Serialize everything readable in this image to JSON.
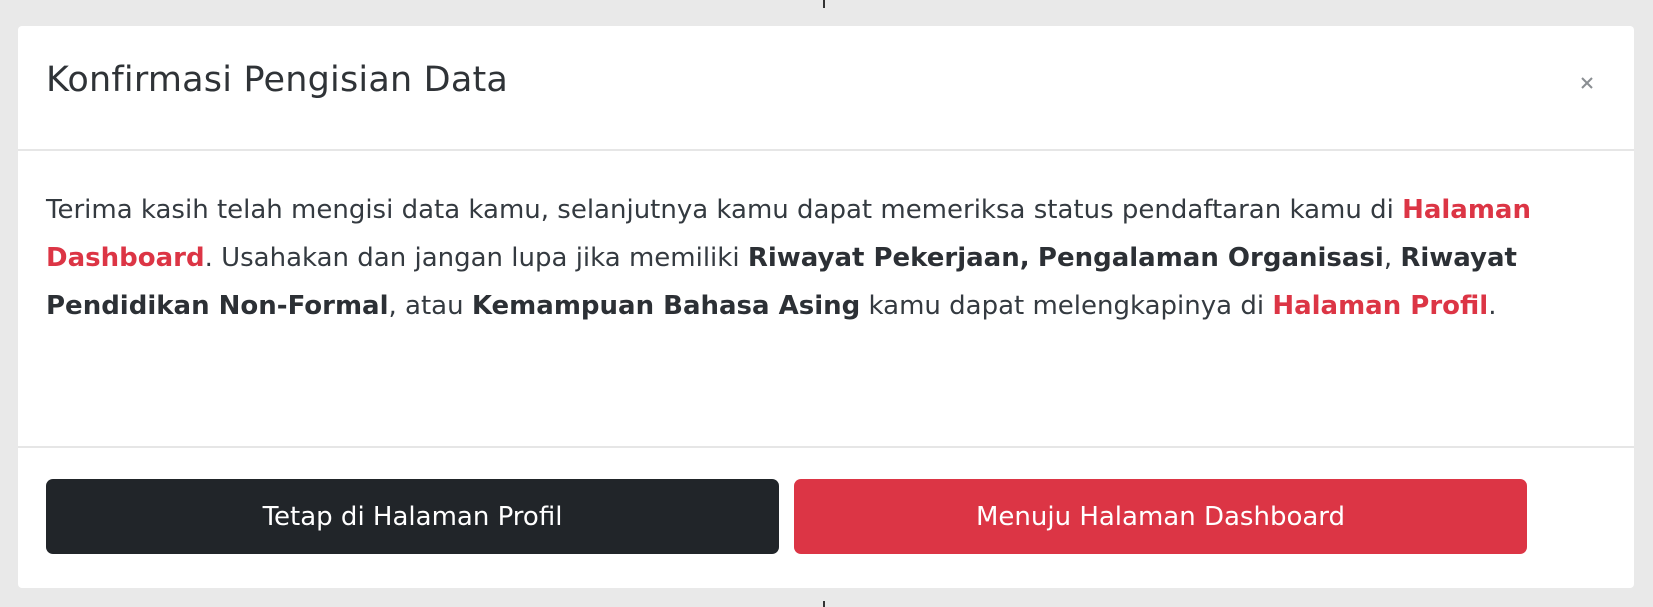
{
  "modal": {
    "title": "Konfirmasi Pengisian Data",
    "close_icon": "close-icon",
    "body": {
      "text_1": "Terima kasih telah mengisi data kamu, selanjutnya kamu dapat memeriksa status pendaftaran kamu di ",
      "link_dashboard": "Halaman Dashboard",
      "text_2": ". Usahakan dan jangan lupa jika memiliki ",
      "bold_1": "Riwayat Pekerjaan,",
      "text_3": " ",
      "bold_2": "Pengalaman Organisasi",
      "text_4": ", ",
      "bold_3": "Riwayat Pendidikan Non-Formal",
      "text_5": ", atau ",
      "bold_4": "Kemampuan Bahasa Asing",
      "text_6": " kamu dapat melengkapinya di ",
      "link_profil": "Halaman Profil",
      "text_7": "."
    },
    "footer": {
      "stay_label": "Tetap di Halaman Profil",
      "go_label": "Menuju Halaman Dashboard"
    }
  },
  "colors": {
    "accent_red": "#dc3545",
    "dark_button": "#212529",
    "backdrop": "#e9e9e9"
  }
}
